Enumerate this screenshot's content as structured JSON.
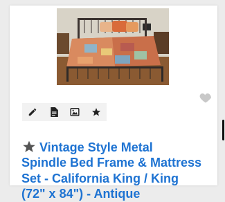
{
  "listing": {
    "title": "Vintage Style Metal\nSpindle Bed Frame & Mattress\nSet - California King / King\n(72\" x 84\") - Antique",
    "image_alt": "Bed frame photo"
  },
  "icons": {
    "favorite": "heart-icon",
    "edit": "pencil-icon",
    "document": "document-icon",
    "image": "image-icon",
    "star": "star-icon",
    "title_badge": "star-icon"
  },
  "colors": {
    "title": "#1e73d2",
    "icon": "#222222",
    "heart": "#c8c8c8",
    "title_star": "#555555"
  }
}
